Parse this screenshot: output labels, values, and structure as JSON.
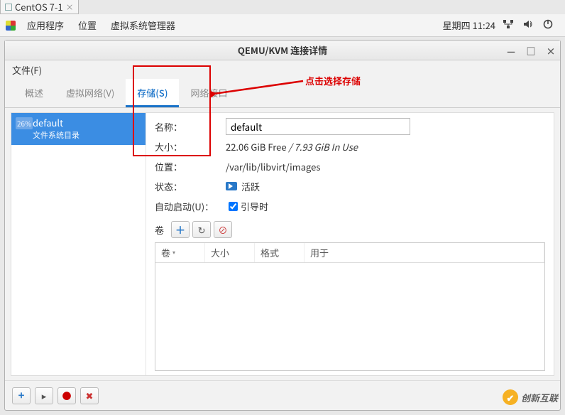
{
  "os_tab": {
    "label": "CentOS 7-1",
    "close_glyph": "×"
  },
  "menubar": {
    "apps": "应用程序",
    "places": "位置",
    "vmm": "虚拟系统管理器",
    "clock": "星期四 11:24"
  },
  "window": {
    "title": "QEMU/KVM 连接详情",
    "btn_min": "—",
    "btn_max": "□",
    "btn_close": "×",
    "file_menu": "文件(F)"
  },
  "tabs": {
    "overview": "概述",
    "vnet": "虚拟网络(V)",
    "storage": "存储(S)",
    "netif": "网络接口"
  },
  "pool": {
    "pct": "26%",
    "name": "default",
    "sub": "文件系统目录"
  },
  "detail": {
    "name_label": "名称：",
    "name_value": "default",
    "size_label": "大小：",
    "size_value_free": "22.06 GiB Free",
    "size_sep": " / ",
    "size_value_used": "7.93 GiB In Use",
    "loc_label": "位置：",
    "loc_value": "/var/lib/libvirt/images",
    "state_label": "状态：",
    "state_value": "活跃",
    "auto_label": "自动启动(U)：",
    "auto_value": "引导时",
    "vol_label": "卷"
  },
  "volhead": {
    "c1": "卷",
    "c2": "大小",
    "c3": "格式",
    "c4": "用于"
  },
  "bottom": {
    "plus": "+",
    "play": "▸",
    "stop": "●",
    "del": "✖"
  },
  "annotation": {
    "text": "点击选择存储"
  },
  "watermark": {
    "text": "创新互联"
  }
}
